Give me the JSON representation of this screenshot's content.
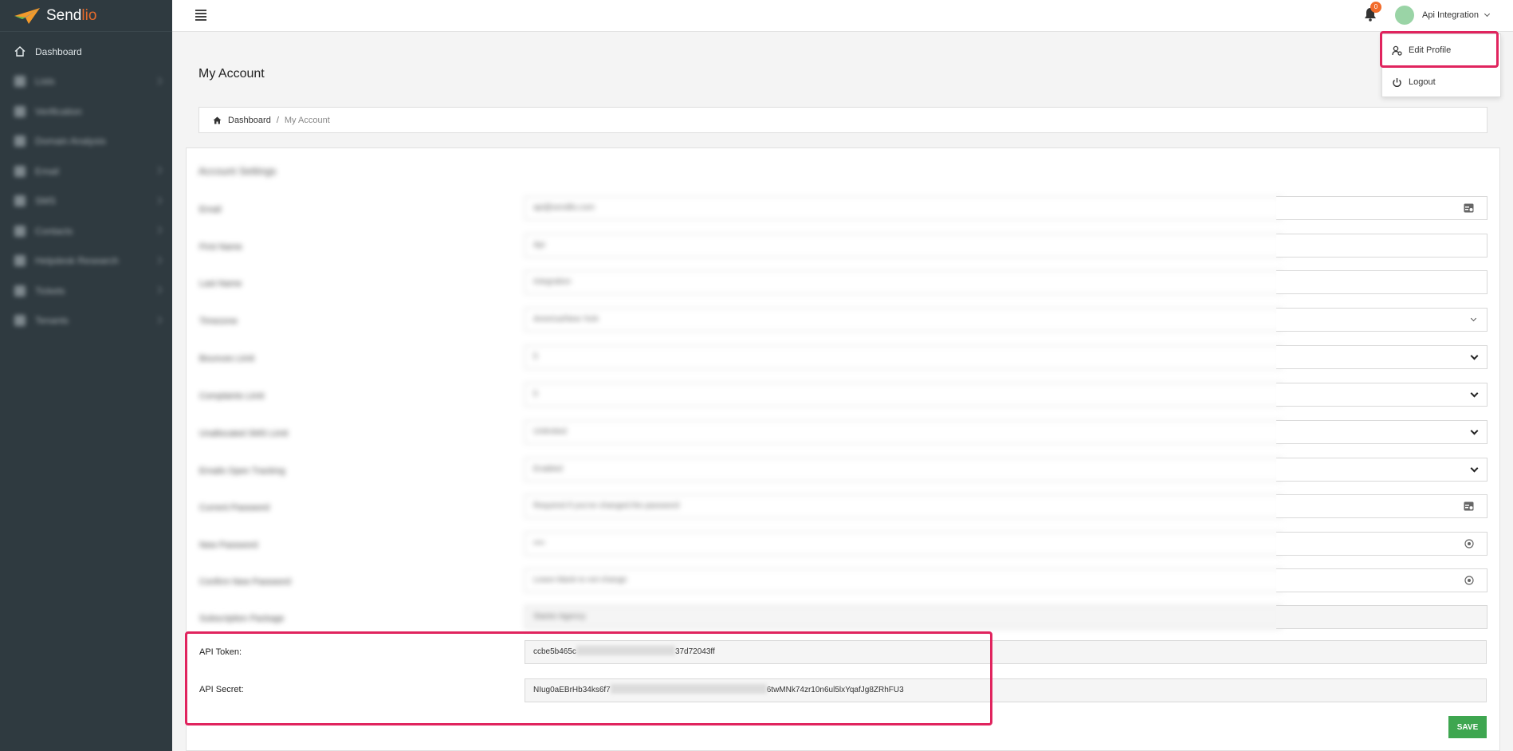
{
  "brand": {
    "name_main": "Send",
    "name_accent": "lio"
  },
  "sidebar": {
    "items": [
      {
        "label": "Dashboard",
        "icon": "home-icon",
        "visible": true,
        "has_children": false
      },
      {
        "label": "Lists",
        "icon": "list-icon",
        "visible": false,
        "has_children": true
      },
      {
        "label": "Verification",
        "icon": "verify-icon",
        "visible": false,
        "has_children": false
      },
      {
        "label": "Domain Analysis",
        "icon": "domain-icon",
        "visible": false,
        "has_children": false
      },
      {
        "label": "Email",
        "icon": "email-icon",
        "visible": false,
        "has_children": true
      },
      {
        "label": "SMS",
        "icon": "sms-icon",
        "visible": false,
        "has_children": true
      },
      {
        "label": "Contacts",
        "icon": "contacts-icon",
        "visible": false,
        "has_children": true
      },
      {
        "label": "Helpdesk Research",
        "icon": "research-icon",
        "visible": false,
        "has_children": true
      },
      {
        "label": "Tickets",
        "icon": "ticket-icon",
        "visible": false,
        "has_children": true
      },
      {
        "label": "Tenants",
        "icon": "tenant-icon",
        "visible": false,
        "has_children": true
      }
    ]
  },
  "topbar": {
    "notification_count": "0",
    "user_name": "Api Integration"
  },
  "dropdown": {
    "edit_profile": "Edit Profile",
    "logout": "Logout"
  },
  "page": {
    "title": "My Account",
    "breadcrumb": {
      "home": "Dashboard",
      "separator": "/",
      "current": "My Account"
    }
  },
  "form": {
    "title": "Account Settings",
    "rows": [
      {
        "label": "Email",
        "value": "api@sendlio.com",
        "kind": "text",
        "end_icon": "card-icon"
      },
      {
        "label": "First Name",
        "value": "Api",
        "kind": "text"
      },
      {
        "label": "Last Name",
        "value": "Integration",
        "kind": "text"
      },
      {
        "label": "Timezone",
        "value": "America/New York",
        "kind": "select-small"
      },
      {
        "label": "Bounces Limit",
        "value": "5",
        "kind": "select"
      },
      {
        "label": "Complaints Limit",
        "value": "5",
        "kind": "select"
      },
      {
        "label": "Unallocated SMS Limit",
        "value": "Unlimited",
        "kind": "select"
      },
      {
        "label": "Emails Open Tracking",
        "value": "Enabled",
        "kind": "select"
      },
      {
        "label": "Current Password",
        "value": "Required if you've changed the password",
        "kind": "password",
        "end_icon": "card-icon"
      },
      {
        "label": "New Password",
        "value": "••••",
        "kind": "password",
        "end_icon": "eye-icon"
      },
      {
        "label": "Confirm New Password",
        "value": "Leave blank to not change",
        "kind": "password",
        "end_icon": "eye-icon"
      },
      {
        "label": "Subscription Package",
        "value": "Starter Agency",
        "kind": "readonly"
      }
    ],
    "api_token": {
      "label": "API Token:",
      "prefix": "ccbe5b465c",
      "suffix": "37d72043ff"
    },
    "api_secret": {
      "label": "API Secret:",
      "prefix": "NIug0aEBrHb34ks6f7",
      "suffix": "6twMNk74zr10n6ul5lxYqafJg8ZRhFU3"
    },
    "save_label": "SAVE"
  },
  "colors": {
    "sidebar_bg": "#2f3a40",
    "highlight": "#e0245e",
    "save_button": "#3ea650",
    "badge": "#f26b2a"
  }
}
